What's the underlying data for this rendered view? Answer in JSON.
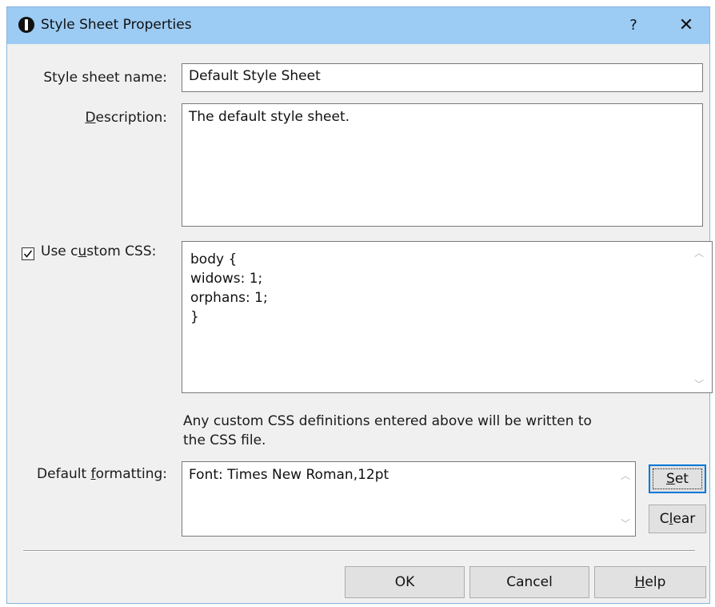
{
  "window": {
    "title": "Style Sheet Properties",
    "help_label": "?",
    "close_label": "✕"
  },
  "form": {
    "name_label": "Style sheet name:",
    "name_value": "Default Style Sheet",
    "description_label": "Description:",
    "description_value": "The default style sheet.",
    "custom_css_label": "Use custom CSS:",
    "custom_css_checked": true,
    "custom_css_value": "body {\nwidows: 1;\norphans: 1;\n}",
    "custom_css_note": "Any custom CSS definitions entered above will be written to the CSS file.",
    "formatting_label": "Default formatting:",
    "formatting_value": "Font: Times New Roman,12pt"
  },
  "buttons": {
    "set": "Set",
    "clear": "Clear",
    "ok": "OK",
    "cancel": "Cancel",
    "help": "Help"
  }
}
